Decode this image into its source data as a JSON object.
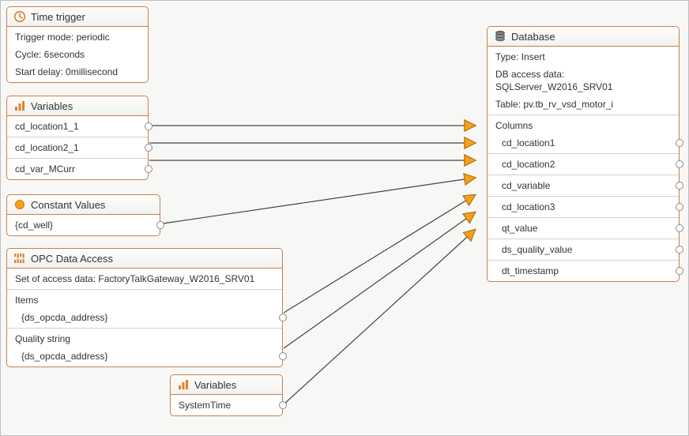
{
  "timeTrigger": {
    "title": "Time trigger",
    "mode_line": "Trigger mode: periodic",
    "cycle_line": "Cycle: 6seconds",
    "delay_line": "Start delay: 0millisecond"
  },
  "variables1": {
    "title": "Variables",
    "rows": [
      "cd_location1_1",
      "cd_location2_1",
      "cd_var_MCurr"
    ]
  },
  "constant": {
    "title": "Constant Values",
    "value": "{cd_well}"
  },
  "opc": {
    "title": "OPC Data Access",
    "access_data_line": "Set of access data: FactoryTalkGateway_W2016_SRV01",
    "items_header": "Items",
    "item_row": "{ds_opcda_address}",
    "quality_header": "Quality string",
    "quality_row": "{ds_opcda_address}"
  },
  "variables2": {
    "title": "Variables",
    "row": "SystemTime"
  },
  "database": {
    "title": "Database",
    "type_line": "Type: Insert",
    "access_line": "DB access data: SQLServer_W2016_SRV01",
    "table_line": "Table: pv.tb_rv_vsd_motor_i",
    "columns_header": "Columns",
    "columns": [
      "cd_location1",
      "cd_location2",
      "cd_variable",
      "cd_location3",
      "qt_value",
      "ds_quality_value",
      "dt_timestamp"
    ]
  },
  "colors": {
    "border": "#c9804a",
    "arrow_fill": "#f4a11b",
    "arrow_stroke": "#b07412"
  }
}
